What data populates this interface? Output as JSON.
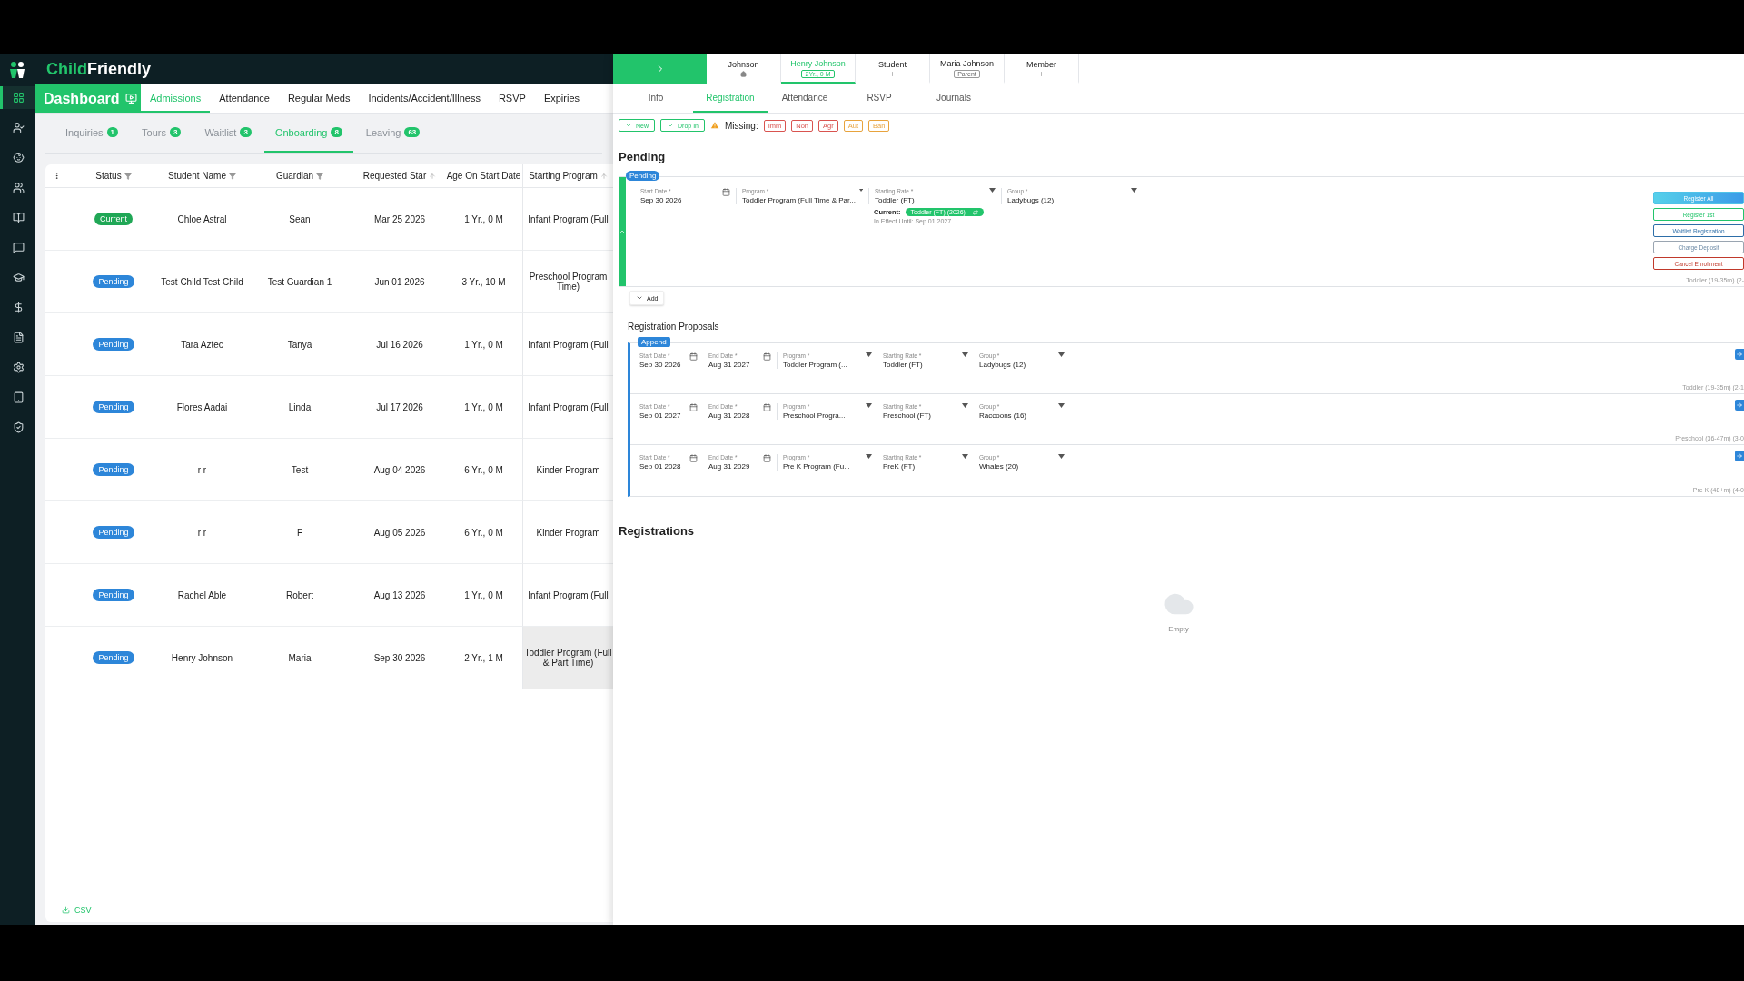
{
  "logo": {
    "first": "Child",
    "second": "Friendly"
  },
  "sidebar": {
    "items": [
      {
        "selected": true
      },
      {
        "selected": false
      },
      {
        "selected": false
      },
      {
        "selected": false
      },
      {
        "selected": false
      },
      {
        "selected": false
      },
      {
        "selected": false
      },
      {
        "selected": false
      },
      {
        "selected": false
      },
      {
        "selected": false
      },
      {
        "selected": false
      },
      {
        "selected": false
      }
    ]
  },
  "dashboard": {
    "title": "Dashboard"
  },
  "main_tabs": [
    {
      "label": "Admissions",
      "selected": true
    },
    {
      "label": "Attendance",
      "selected": false
    },
    {
      "label": "Regular Meds",
      "selected": false
    },
    {
      "label": "Incidents/Accident/Illness",
      "selected": false
    },
    {
      "label": "RSVP",
      "selected": false
    },
    {
      "label": "Expiries",
      "selected": false
    }
  ],
  "sub_tabs": [
    {
      "label": "Inquiries",
      "count": "1",
      "selected": false
    },
    {
      "label": "Tours",
      "count": "3",
      "selected": false
    },
    {
      "label": "Waitlist",
      "count": "3",
      "selected": false
    },
    {
      "label": "Onboarding",
      "count": "8",
      "selected": true
    },
    {
      "label": "Leaving",
      "count": "63",
      "selected": false
    }
  ],
  "table": {
    "columns": [
      {
        "label": "Status",
        "kind": "filter"
      },
      {
        "label": "Student Name",
        "kind": "filter"
      },
      {
        "label": "Guardian",
        "kind": "filter"
      },
      {
        "label": "Requested Star",
        "kind": "sort"
      },
      {
        "label": "Age On Start Date",
        "kind": "plain"
      },
      {
        "label": "Starting Program",
        "kind": "sort"
      }
    ],
    "rows": [
      {
        "status": "Current",
        "kind": "current",
        "student": "Chloe Astral",
        "guardian": "Sean",
        "requested": "Mar 25 2026",
        "age": "1 Yr., 0 M",
        "program": "Infant Program (Full",
        "selected": false
      },
      {
        "status": "Pending",
        "kind": "pending",
        "student": "Test Child Test Child",
        "guardian": "Test Guardian 1",
        "requested": "Jun 01 2026",
        "age": "3 Yr., 10 M",
        "program": "Preschool Program\nTime)",
        "selected": false
      },
      {
        "status": "Pending",
        "kind": "pending",
        "student": "Tara Aztec",
        "guardian": "Tanya",
        "requested": "Jul 16 2026",
        "age": "1 Yr., 0 M",
        "program": "Infant Program (Full",
        "selected": false
      },
      {
        "status": "Pending",
        "kind": "pending",
        "student": "Flores Aadai",
        "guardian": "Linda",
        "requested": "Jul 17 2026",
        "age": "1 Yr., 0 M",
        "program": "Infant Program (Full",
        "selected": false
      },
      {
        "status": "Pending",
        "kind": "pending",
        "student": "r r",
        "guardian": "Test",
        "requested": "Aug 04 2026",
        "age": "6 Yr., 0 M",
        "program": "Kinder Program",
        "selected": false
      },
      {
        "status": "Pending",
        "kind": "pending",
        "student": "r r",
        "guardian": "F",
        "requested": "Aug 05 2026",
        "age": "6 Yr., 0 M",
        "program": "Kinder Program",
        "selected": false
      },
      {
        "status": "Pending",
        "kind": "pending",
        "student": "Rachel Able",
        "guardian": "Robert",
        "requested": "Aug 13 2026",
        "age": "1 Yr., 0 M",
        "program": "Infant Program (Full",
        "selected": false
      },
      {
        "status": "Pending",
        "kind": "pending",
        "student": "Henry Johnson",
        "guardian": "Maria",
        "requested": "Sep 30 2026",
        "age": "2 Yr., 1 M",
        "program": "Toddler Program (Full\n& Part Time)",
        "selected": true
      }
    ]
  },
  "csv": "CSV",
  "people": [
    {
      "name": "Johnson",
      "kind": "home",
      "selected": false
    },
    {
      "name": "Henry Johnson",
      "kind": "badge",
      "sub": "2Yr., 0 M",
      "selected": true
    },
    {
      "name": "Student",
      "kind": "plus",
      "selected": false
    },
    {
      "name": "Maria Johnson",
      "kind": "badge",
      "sub": "Parent",
      "selected": false
    },
    {
      "name": "Member",
      "kind": "plus",
      "selected": false
    }
  ],
  "detail_tabs": [
    {
      "label": "Info",
      "selected": false
    },
    {
      "label": "Registration",
      "selected": true
    },
    {
      "label": "Attendance",
      "selected": false
    },
    {
      "label": "RSVP",
      "selected": false
    },
    {
      "label": "Journals",
      "selected": false
    }
  ],
  "toolbar": {
    "buttons": [
      "New",
      "Drop In"
    ],
    "missing_label": "Missing:",
    "missing": [
      {
        "label": "Imm",
        "color": "#d9534f"
      },
      {
        "label": "Non",
        "color": "#d9534f"
      },
      {
        "label": "Agr",
        "color": "#d9534f"
      },
      {
        "label": "Aut",
        "color": "#e8a33d"
      },
      {
        "label": "Ban",
        "color": "#e8a33d"
      }
    ]
  },
  "pending": {
    "title": "Pending",
    "badge": "Pending",
    "fields": [
      {
        "label": "Start Date *",
        "value": "Sep 30 2026",
        "kind": "date"
      },
      {
        "label": "Program *",
        "value": "Toddler Program (Full Time & Par...",
        "kind": "select"
      },
      {
        "label": "Starting Rate *",
        "value": "Toddler (FT)",
        "kind": "select"
      },
      {
        "label": "Group *",
        "value": "Ladybugs (12)",
        "kind": "select"
      }
    ],
    "current_label": "Current:",
    "current_tag": "Toddler (FT) (2026)",
    "in_effect": "In Effect Until: Sep 01 2027",
    "actions": [
      {
        "label": "Register All",
        "kind": "primary"
      },
      {
        "label": "Register 1st",
        "kind": "success"
      },
      {
        "label": "Waitlist Registration",
        "kind": "info"
      },
      {
        "label": "Charge Deposit",
        "kind": "muted"
      },
      {
        "label": "Cancel Enrollment",
        "kind": "danger"
      }
    ],
    "note": "Toddler (19-35m) (2-",
    "add": "Add"
  },
  "proposals": {
    "title": "Registration Proposals",
    "badge": "Append",
    "rows": [
      {
        "fields": [
          {
            "label": "Start Date *",
            "value": "Sep 30 2026",
            "kind": "date"
          },
          {
            "label": "End Date *",
            "value": "Aug 31 2027",
            "kind": "date"
          },
          {
            "label": "Program *",
            "value": "Toddler Program (...",
            "kind": "select"
          },
          {
            "label": "Starting Rate *",
            "value": "Toddler (FT)",
            "kind": "select"
          },
          {
            "label": "Group *",
            "value": "Ladybugs (12)",
            "kind": "select"
          }
        ],
        "note": "Toddler (19-35m) (2-1"
      },
      {
        "fields": [
          {
            "label": "Start Date *",
            "value": "Sep 01 2027",
            "kind": "date"
          },
          {
            "label": "End Date *",
            "value": "Aug 31 2028",
            "kind": "date"
          },
          {
            "label": "Program *",
            "value": "Preschool Progra...",
            "kind": "select"
          },
          {
            "label": "Starting Rate *",
            "value": "Preschool (FT)",
            "kind": "select"
          },
          {
            "label": "Group *",
            "value": "Raccoons (16)",
            "kind": "select"
          }
        ],
        "note": "Preschool (36-47m) (3-0"
      },
      {
        "fields": [
          {
            "label": "Start Date *",
            "value": "Sep 01 2028",
            "kind": "date"
          },
          {
            "label": "End Date *",
            "value": "Aug 31 2029",
            "kind": "date"
          },
          {
            "label": "Program *",
            "value": "Pre K Program (Fu...",
            "kind": "select"
          },
          {
            "label": "Starting Rate *",
            "value": "PreK (FT)",
            "kind": "select"
          },
          {
            "label": "Group *",
            "value": "Whales (20)",
            "kind": "select"
          }
        ],
        "note": "Pre K (48+m) (4-0"
      }
    ]
  },
  "registrations": {
    "title": "Registrations",
    "empty": "Empty"
  }
}
